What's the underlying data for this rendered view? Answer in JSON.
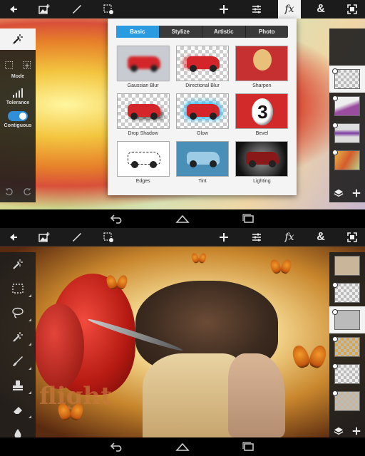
{
  "top_screen": {
    "toolbar_icons": [
      "back-arrow-icon",
      "add-image-icon",
      "brush-icon",
      "selection-options-icon",
      "crosshair-add-icon",
      "adjustments-icon",
      "fx-icon",
      "ampersand-icon",
      "fullscreen-icon"
    ],
    "fx_label": "fx",
    "amp_label": "&",
    "left_tools": {
      "mode_label": "Mode",
      "tolerance_label": "Tolerance",
      "contiguous_label": "Contiguous"
    },
    "fx_panel": {
      "tabs": [
        "Basic",
        "Stylize",
        "Artistic",
        "Photo"
      ],
      "active_tab": "Basic",
      "effects": [
        "Gaussian Blur",
        "Directional Blur",
        "Sharpen",
        "Drop Shadow",
        "Glow",
        "Bevel",
        "Edges",
        "Tint",
        "Lighting"
      ]
    }
  },
  "bottom_screen": {
    "fx_label": "fx",
    "amp_label": "&",
    "canvas_text": "flight"
  },
  "colors": {
    "accent": "#2a9be0",
    "toolbar_bg": "#1b1b1b",
    "panel_bg": "#f4f4f4"
  }
}
